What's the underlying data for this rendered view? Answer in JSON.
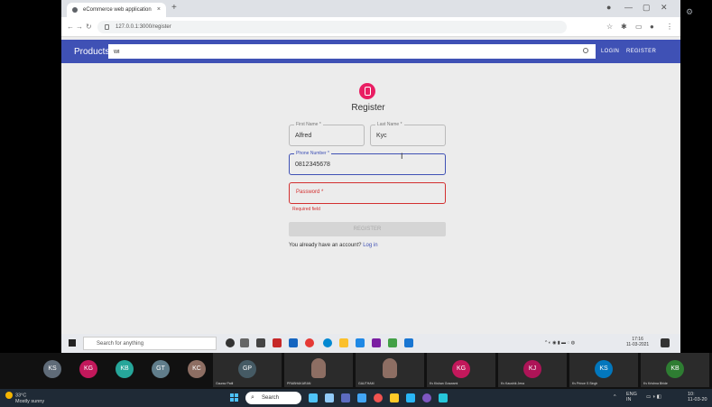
{
  "browser": {
    "tab_title": "eCommerce web application",
    "url": "127.0.0.1:3000/register"
  },
  "app": {
    "brand": "Products",
    "search_value": "wi",
    "login_label": "LOGIN",
    "register_label": "REGISTER"
  },
  "form": {
    "title": "Register",
    "first_name_label": "First Name *",
    "first_name_value": "Alfred",
    "last_name_label": "Last Name *",
    "last_name_value": "Kyc",
    "phone_label": "Phone Number *",
    "phone_value": "0812345678",
    "password_placeholder": "Password *",
    "password_error": "Required field",
    "submit_label": "REGISTER",
    "signin_text": "You already have an account? ",
    "signin_link": "Log in"
  },
  "inner_taskbar": {
    "search_placeholder": "Search for anything",
    "time": "17:16",
    "date": "11-03-2021"
  },
  "participants": [
    {
      "initials": "KS",
      "color": "#5f6b78"
    },
    {
      "initials": "KG",
      "color": "#c2185b"
    },
    {
      "initials": "KB",
      "color": "#26a69a"
    },
    {
      "initials": "GT",
      "color": "#607d8b"
    },
    {
      "initials": "KC",
      "color": "#8d6e63"
    }
  ],
  "video_tiles": [
    {
      "initials": "GP",
      "name": "Gaurav Patil",
      "color": "#455a64",
      "type": "initials"
    },
    {
      "name": "PRABHAKARAN",
      "type": "face"
    },
    {
      "name": "GAUTHAM",
      "type": "face"
    },
    {
      "initials": "KG",
      "name": "Kv Kishan Goswami",
      "color": "#c2185b",
      "type": "initials"
    },
    {
      "initials": "KJ",
      "name": "Kv Kaushik Jena",
      "color": "#ad1457",
      "type": "initials"
    },
    {
      "initials": "KS",
      "name": "Kv Prince S Singh",
      "color": "#0277bd",
      "type": "initials"
    },
    {
      "initials": "KB",
      "name": "Kv Krishna Bhide",
      "color": "#2e7d32",
      "type": "initials"
    }
  ],
  "host_taskbar": {
    "temperature": "33°C",
    "weather": "Mostly sunny",
    "search_label": "Search",
    "lang": "ENG",
    "region": "IN",
    "time": "10:",
    "date": "11-03-20"
  },
  "colors": {
    "navbar": "#3f51b5",
    "error": "#d32f2f",
    "avatar": "#e91e63"
  }
}
